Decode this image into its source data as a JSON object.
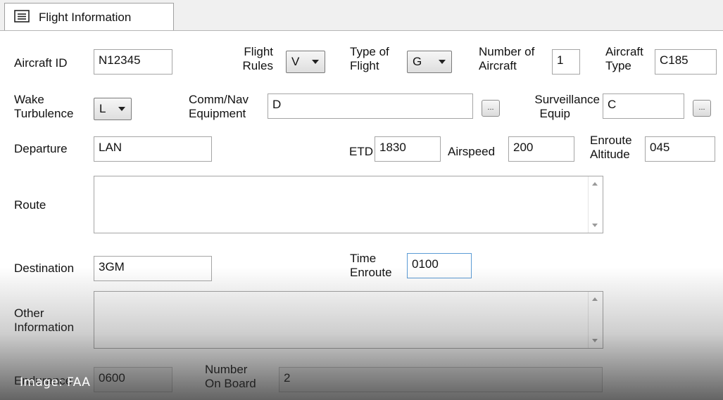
{
  "tab": {
    "label": "Flight Information",
    "icon": "form-list-icon"
  },
  "fields": {
    "aircraft_id": {
      "label": "Aircraft ID",
      "value": "N12345"
    },
    "flight_rules": {
      "label_line1": "Flight",
      "label_line2": "Rules",
      "value": "V"
    },
    "type_of_flight": {
      "label_line1": "Type of",
      "label_line2": "Flight",
      "value": "G"
    },
    "number_of_aircraft": {
      "label_line1": "Number of",
      "label_line2": "Aircraft",
      "value": "1"
    },
    "aircraft_type": {
      "label_line1": "Aircraft",
      "label_line2": "Type",
      "value": "C185"
    },
    "wake_turbulence": {
      "label_line1": "Wake",
      "label_line2": "Turbulence",
      "value": "L"
    },
    "comm_nav_equipment": {
      "label_line1": "Comm/Nav",
      "label_line2": "Equipment",
      "value": "D"
    },
    "surveillance_equip": {
      "label_line1": "Surveillance",
      "label_line2": "Equip",
      "value": "C"
    },
    "departure": {
      "label": "Departure",
      "value": "LAN"
    },
    "etd": {
      "label": "ETD",
      "value": "1830"
    },
    "airspeed": {
      "label": "Airspeed",
      "value": "200"
    },
    "enroute_altitude": {
      "label_line1": "Enroute",
      "label_line2": "Altitude",
      "value": "045"
    },
    "route": {
      "label": "Route",
      "value": ""
    },
    "destination": {
      "label": "Destination",
      "value": "3GM"
    },
    "time_enroute": {
      "label_line1": "Time",
      "label_line2": "Enroute",
      "value": "0100"
    },
    "other_information": {
      "label_line1": "Other",
      "label_line2": "Information",
      "value": ""
    },
    "endurance": {
      "label": "Endurance",
      "value": "0600"
    },
    "number_on_board": {
      "label_line1": "Number",
      "label_line2": "On Board",
      "value": "2"
    }
  },
  "ellipsis_label": "...",
  "image_credit": "Image: FAA"
}
